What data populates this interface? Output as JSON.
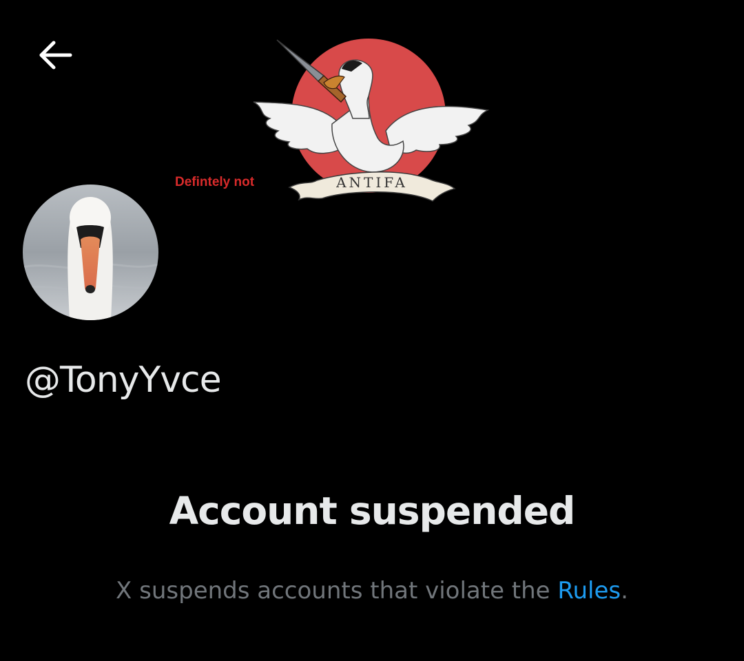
{
  "header": {
    "back_icon": "arrow-left-icon"
  },
  "banner": {
    "caption": "Defintely not",
    "scroll_text": "ANTIFA",
    "colors": {
      "circle": "#d84a4a",
      "swan": "#f2f2f2",
      "knife": "#8a8f96",
      "handle": "#a5652b",
      "caption": "#d92b2b"
    }
  },
  "profile": {
    "avatar_icon": "swan-avatar",
    "handle": "@TonyYvce"
  },
  "suspension": {
    "title": "Account suspended",
    "description": "X suspends accounts that violate the ",
    "link_text": "Rules",
    "trailing": ".",
    "link_color": "#1d9bf0"
  }
}
